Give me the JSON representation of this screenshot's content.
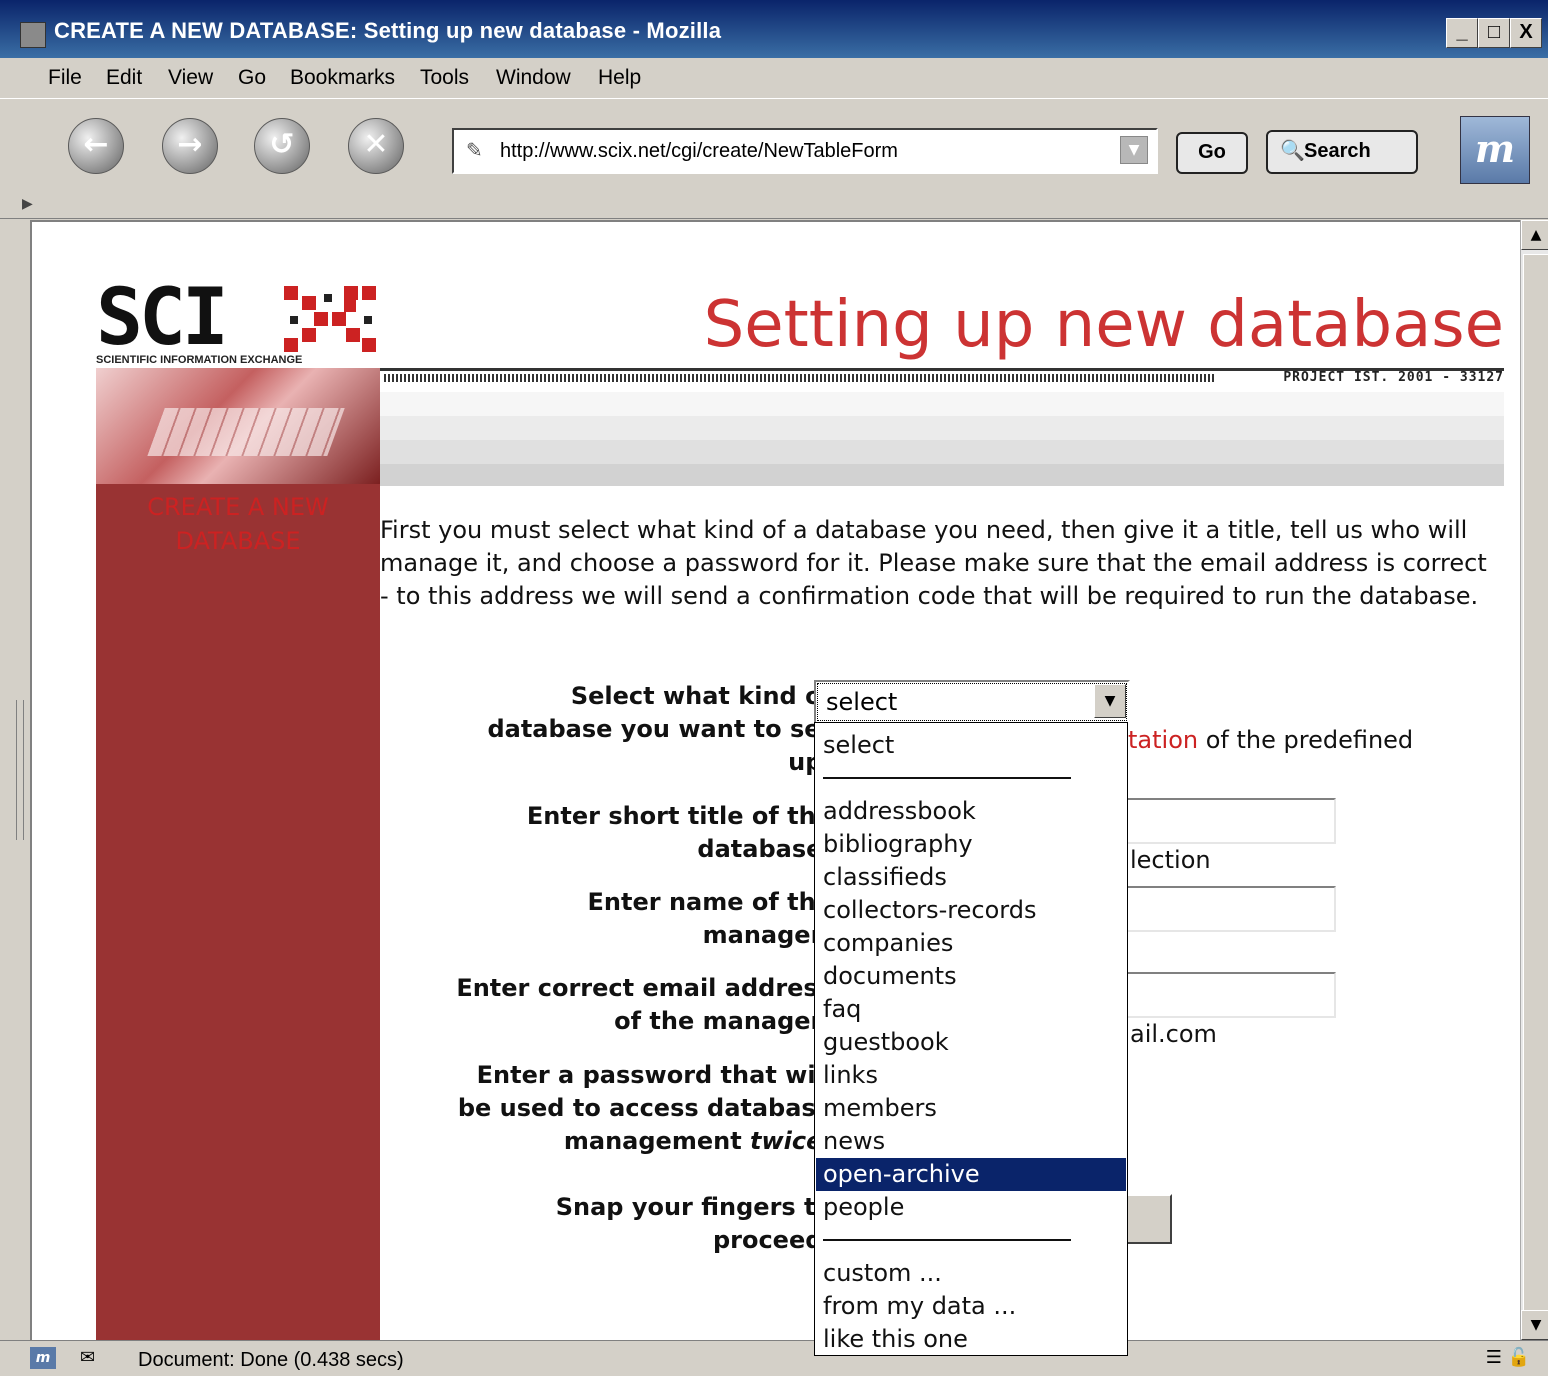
{
  "window": {
    "title": "CREATE A NEW DATABASE: Setting up new database - Mozilla",
    "controls": [
      "_",
      "□",
      "X"
    ]
  },
  "menubar": [
    "File",
    "Edit",
    "View",
    "Go",
    "Bookmarks",
    "Tools",
    "Window",
    "Help"
  ],
  "navbar": {
    "url": "http://www.scix.net/cgi/create/NewTableForm",
    "go_label": "Go",
    "search_label": "Search"
  },
  "page": {
    "logo_text": "SCI",
    "logo_sub": "SCIENTIFIC INFORMATION EXCHANGE",
    "heading": "Setting up new database",
    "project": "PROJECT IST. 2001 - 33127",
    "sidebar_link": "CREATE A NEW DATABASE",
    "intro": "First you must select what kind of a database you need, then give it a title, tell us who will manage it, and choose a password for it. Please make sure that the email address is correct - to this address we will send a confirmation code that will be required to run the database."
  },
  "form": {
    "label_kind_1": "Select what kind of",
    "label_kind_2": "database you want to set",
    "label_kind_3": "up:",
    "label_title_1": "Enter short title of the",
    "label_title_2": "database:",
    "label_manager_1": "Enter name of the",
    "label_manager_2": "manager:",
    "label_email_1": "Enter correct email address",
    "label_email_2": "of the manager:",
    "label_pw_1": "Enter a password that will",
    "label_pw_2": "be used to access database",
    "label_pw_3a": "management ",
    "label_pw_3b": "twice",
    "label_pw_3c": ":",
    "label_snap_1": "Snap your fingers to",
    "label_snap_2": "proceed:",
    "hint_kind_red": "tation",
    "hint_kind_black": " of the predefined",
    "hint_title": "lection",
    "hint_email": "ail.com",
    "select_value": "select"
  },
  "dropdown": {
    "options": [
      "select",
      "addressbook",
      "bibliography",
      "classifieds",
      "collectors-records",
      "companies",
      "documents",
      "faq",
      "guestbook",
      "links",
      "members",
      "news",
      "open-archive",
      "people",
      "custom ...",
      "from my data ...",
      "like this one"
    ],
    "highlighted": "open-archive"
  },
  "statusbar": {
    "text": "Document: Done (0.438 secs)"
  }
}
